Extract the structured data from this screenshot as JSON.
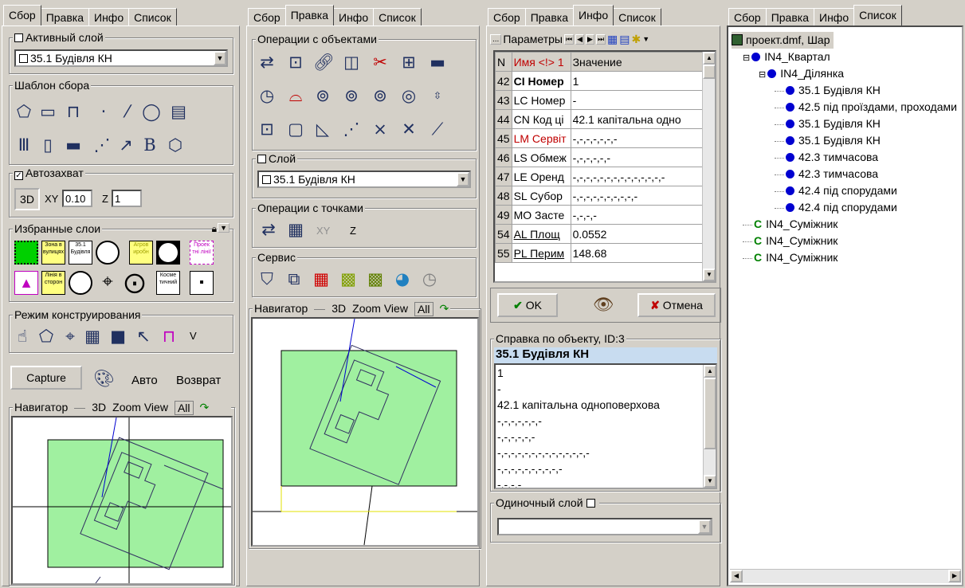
{
  "tabs": {
    "collect": "Сбор",
    "edit": "Правка",
    "info": "Инфо",
    "list": "Список"
  },
  "p1": {
    "active_layer_title": "Активный слой",
    "active_layer_value": "35.1 Будівля КН",
    "template_title": "Шаблон сбора",
    "autocapture_label": "Автозахват",
    "mode3d": "3D",
    "xy_label": "XY",
    "xy_value": "0.10",
    "z_label": "Z",
    "z_value": "1",
    "favorites_title": "Избранные слои",
    "favorites": [
      "Зона в вулицях",
      "35.1 Будівля",
      "",
      "Агров иробн",
      "",
      "Проек тні лінії",
      "",
      "Лінія в сторон",
      "",
      "",
      "",
      "Косме тичний",
      ""
    ],
    "construct_title": "Режим конструирования",
    "construct_v": "V",
    "capture_button": "Capture",
    "auto_label": "Авто",
    "return_label": "Возврат",
    "navigator_title": "Навигатор",
    "nav_3d": "3D",
    "nav_zoom": "Zoom View",
    "nav_all": "All"
  },
  "p2": {
    "ops_title": "Операции с объектами",
    "layer_title": "Слой",
    "layer_value": "35.1 Будівля КН",
    "points_title": "Операции с точками",
    "points_xy": "XY",
    "points_z": "Z",
    "service_title": "Сервис",
    "navigator_title": "Навигатор",
    "nav_3d": "3D",
    "nav_zoom": "Zoom View",
    "nav_all": "All"
  },
  "p3": {
    "params_title": "Параметры",
    "col_n": "N",
    "col_name": "Имя <!> 1",
    "col_value": "Значение",
    "rows": [
      {
        "n": "42",
        "name": "CI Номер",
        "value": "1",
        "style": "bold"
      },
      {
        "n": "43",
        "name": "LC Номер",
        "value": "-",
        "style": "normal"
      },
      {
        "n": "44",
        "name": "CN Код ці",
        "value": "42.1 капітальна одно",
        "style": "normal"
      },
      {
        "n": "45",
        "name": "LM Сервіт",
        "value": "-,-,-,-,-,-,-",
        "style": "red"
      },
      {
        "n": "46",
        "name": "LS Обмеж",
        "value": "-,-,-,-,-,-",
        "style": "normal"
      },
      {
        "n": "47",
        "name": "LE Оренд",
        "value": "-,-,-,-,-,-,-,-,-,-,-,-,-,-",
        "style": "normal"
      },
      {
        "n": "48",
        "name": "SL Субор",
        "value": "-,-,-,-,-,-,-,-,-,-",
        "style": "normal"
      },
      {
        "n": "49",
        "name": "MO Засте",
        "value": "-,-,-,-",
        "style": "normal"
      },
      {
        "n": "54",
        "name": "AL Площ",
        "value": "0.0552",
        "style": "underline"
      },
      {
        "n": "55",
        "name": "PL Перим",
        "value": "148.68",
        "style": "underline"
      }
    ],
    "ok_label": "OK",
    "cancel_label": "Отмена",
    "help_title": "Справка по объекту, ID:3",
    "help_header": "35.1 Будівля КН",
    "help_lines": [
      "1",
      "-",
      "42.1 капітальна одноповерхова",
      "-,-,-,-,-,-,-",
      "-,-,-,-,-,-",
      "-,-,-,-,-,-,-,-,-,-,-,-,-,-",
      "-,-,-,-,-,-,-,-,-,-",
      "-,-,-,-"
    ],
    "single_layer_label": "Одиночный слой"
  },
  "p4": {
    "root": "проект.dmf, Шар",
    "items": [
      {
        "label": "IN4_Квартал",
        "level": 1,
        "kind": "dot",
        "exp": "⊟"
      },
      {
        "label": "IN4_Ділянка",
        "level": 2,
        "kind": "dot",
        "exp": "⊟"
      },
      {
        "label": "35.1 Будівля КН",
        "level": 3,
        "kind": "dot",
        "exp": ""
      },
      {
        "label": "42.5 під проїздами, проходами",
        "level": 3,
        "kind": "dot",
        "exp": ""
      },
      {
        "label": "35.1 Будівля КН",
        "level": 3,
        "kind": "dot",
        "exp": ""
      },
      {
        "label": "35.1 Будівля КН",
        "level": 3,
        "kind": "dot",
        "exp": ""
      },
      {
        "label": "42.3 тимчасова",
        "level": 3,
        "kind": "dot",
        "exp": ""
      },
      {
        "label": "42.3 тимчасова",
        "level": 3,
        "kind": "dot",
        "exp": ""
      },
      {
        "label": "42.4 під спорудами",
        "level": 3,
        "kind": "dot",
        "exp": ""
      },
      {
        "label": "42.4 під спорудами",
        "level": 3,
        "kind": "dot",
        "exp": ""
      },
      {
        "label": "IN4_Суміжник",
        "level": 1,
        "kind": "c",
        "exp": ""
      },
      {
        "label": "IN4_Суміжник",
        "level": 1,
        "kind": "c",
        "exp": ""
      },
      {
        "label": "IN4_Суміжник",
        "level": 1,
        "kind": "c",
        "exp": ""
      }
    ]
  }
}
